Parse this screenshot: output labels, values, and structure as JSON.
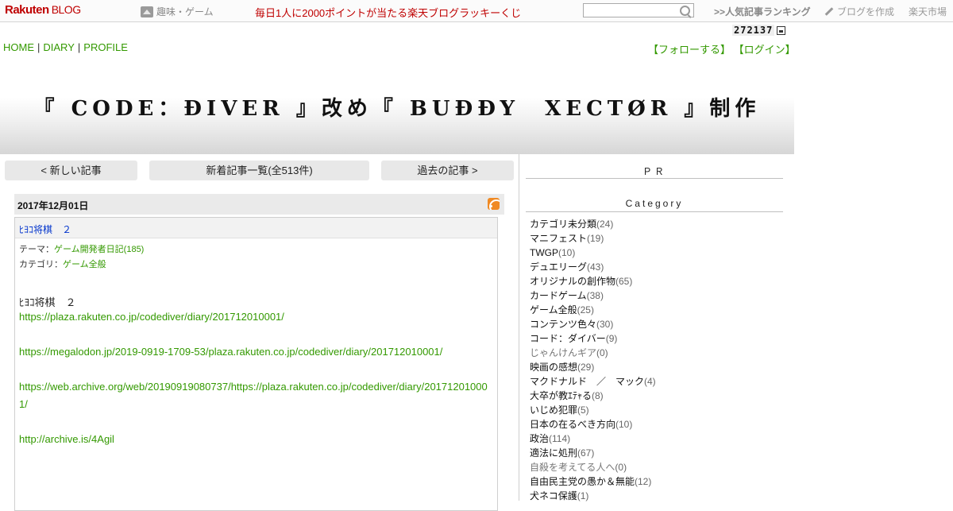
{
  "topbar": {
    "logo_main": "Rakuten",
    "logo_sub": "BLOG",
    "hobby": "趣味・ゲーム",
    "lucky": "毎日1人に2000ポイントが当たる楽天ブログラッキーくじ",
    "search_value": "",
    "ranking": ">>人気記事ランキング",
    "create": "ブログを作成",
    "market": "楽天市場"
  },
  "counter": "272137",
  "nav": {
    "home": "HOME",
    "diary": "DIARY",
    "profile": "PROFILE",
    "follow": "【フォローする】",
    "login": "【ログイン】"
  },
  "banner_title": "『 CODE：ÐIVER 』改め『 BUÐÐY　XECTØR 』制作",
  "pager": {
    "newer": "< 新しい記事",
    "list": "新着記事一覧(全513件)",
    "older": "過去の記事 >"
  },
  "entry": {
    "date": "2017年12月01日",
    "title": "ﾋﾖｺ将棋　２",
    "theme_label": "テーマ：",
    "theme": "ゲーム開発者日記(185)",
    "category_label": "カテゴリ：",
    "category": "ゲーム全般",
    "body_title": "ﾋﾖｺ将棋　２",
    "links": [
      "https://plaza.rakuten.co.jp/codediver/diary/201712010001/",
      "https://megalodon.jp/2019-0919-1709-53/plaza.rakuten.co.jp/codediver/diary/201712010001/",
      "https://web.archive.org/web/20190919080737/https://plaza.rakuten.co.jp/codediver/diary/201712010001/",
      "http://archive.is/4Agil"
    ]
  },
  "sidebar": {
    "pr": "ＰＲ",
    "category_heading": "Category",
    "categories": [
      {
        "name": "カテゴリ未分類",
        "count": "(24)"
      },
      {
        "name": "マニフェスト",
        "count": "(19)"
      },
      {
        "name": "TWGP",
        "count": "(10)"
      },
      {
        "name": "デュエリーグ",
        "count": "(43)"
      },
      {
        "name": "オリジナルの創作物",
        "count": "(65)"
      },
      {
        "name": "カードゲーム",
        "count": "(38)"
      },
      {
        "name": "ゲーム全般",
        "count": "(25)"
      },
      {
        "name": "コンテンツ色々",
        "count": "(30)"
      },
      {
        "name": "コード：ダイバー",
        "count": "(9)"
      },
      {
        "name": "じゃんけんギア",
        "count": "(0)"
      },
      {
        "name": "映画の感想",
        "count": "(29)"
      },
      {
        "name": "マクドナルド　／　マック",
        "count": "(4)"
      },
      {
        "name": "大卒が教ｴﾃｬる",
        "count": "(8)"
      },
      {
        "name": "いじめ犯罪",
        "count": "(5)"
      },
      {
        "name": "日本の在るべき方向",
        "count": "(10)"
      },
      {
        "name": "政治",
        "count": "(114)"
      },
      {
        "name": "適法に処刑",
        "count": "(67)"
      },
      {
        "name": "自殺を考えてる人へ",
        "count": "(0)"
      },
      {
        "name": "自由民主党の愚か＆無能",
        "count": "(12)"
      },
      {
        "name": "犬ネコ保護",
        "count": "(1)"
      }
    ]
  }
}
